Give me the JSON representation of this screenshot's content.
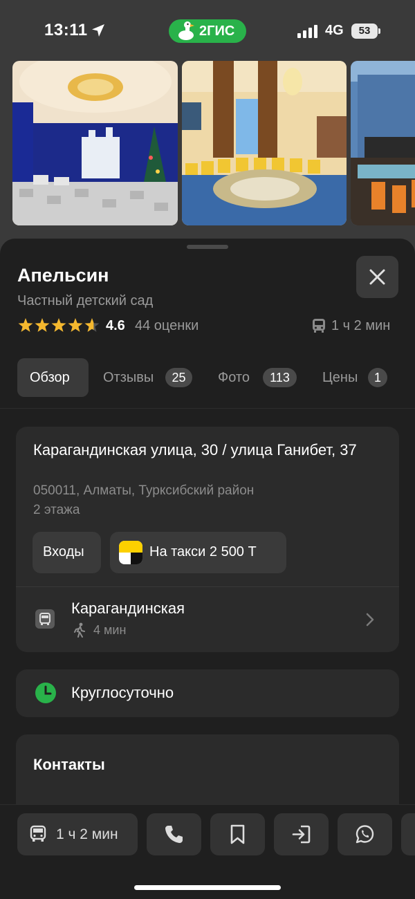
{
  "status_bar": {
    "time": "13:11",
    "app_name": "2ГИС",
    "network": "4G",
    "battery_level": "53"
  },
  "place": {
    "name": "Апельсин",
    "category": "Частный детский сад",
    "rating": "4.6",
    "rating_value": 4.6,
    "rating_count": "44 оценки",
    "travel_time": "1 ч 2 мин"
  },
  "tabs": [
    {
      "label": "Обзор",
      "count": ""
    },
    {
      "label": "Отзывы",
      "count": "25"
    },
    {
      "label": "Фото",
      "count": "113"
    },
    {
      "label": "Цены",
      "count": "1"
    }
  ],
  "address": {
    "street": "Карагандинская улица, 30 / улица Ганибет, 37",
    "city": "050011, Алматы, Турксибский район",
    "floors": "2 этажа",
    "entrances_label": "Входы",
    "taxi_label": "На такси 2 500 Т",
    "stop_name": "Карагандинская",
    "stop_walk": "4 мин"
  },
  "hours": {
    "text": "Круглосуточно"
  },
  "contacts": {
    "title": "Контакты"
  },
  "bottom_bar": {
    "route_label": "1 ч 2 мин"
  },
  "colors": {
    "accent": "#29b24a",
    "sheet_bg": "#1f1f1f",
    "card_bg": "#2b2b2b",
    "star": "#f5b82e"
  },
  "icons": [
    "location-arrow-icon",
    "goose-icon",
    "signal-icon",
    "close-icon",
    "bus-icon",
    "walk-icon",
    "chevron-right-icon",
    "clock-icon",
    "phone-icon",
    "bookmark-icon",
    "enter-icon",
    "whatsapp-icon"
  ]
}
